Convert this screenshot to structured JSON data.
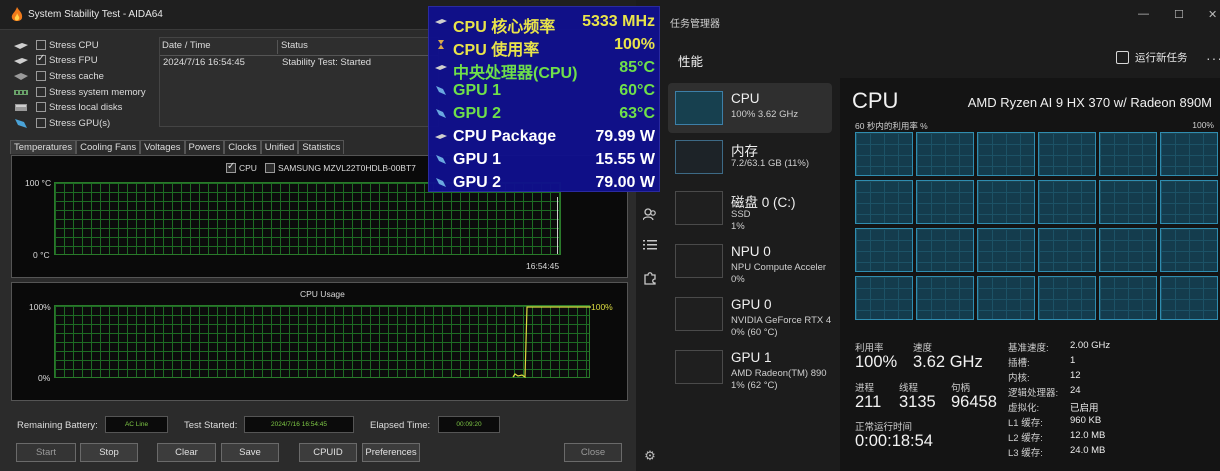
{
  "aida": {
    "title": "System Stability Test - AIDA64",
    "stress_items": [
      {
        "label": "Stress CPU",
        "checked": false,
        "icon": "cpu-icon"
      },
      {
        "label": "Stress FPU",
        "checked": true,
        "icon": "fpu-icon"
      },
      {
        "label": "Stress cache",
        "checked": false,
        "icon": "cache-icon"
      },
      {
        "label": "Stress system memory",
        "checked": false,
        "icon": "memory-icon"
      },
      {
        "label": "Stress local disks",
        "checked": false,
        "icon": "disk-icon"
      },
      {
        "label": "Stress GPU(s)",
        "checked": false,
        "icon": "gpu-icon"
      }
    ],
    "status_table": {
      "headers": [
        "Date / Time",
        "Status"
      ],
      "rows": [
        [
          "2024/7/16 16:54:45",
          "Stability Test: Started"
        ]
      ]
    },
    "tabs": [
      "Temperatures",
      "Cooling Fans",
      "Voltages",
      "Powers",
      "Clocks",
      "Unified",
      "Statistics"
    ],
    "active_tab": "Temperatures",
    "temp_graph": {
      "legend": [
        {
          "label": "CPU",
          "checked": true
        },
        {
          "label": "SAMSUNG MZVL22T0HDLB-00BT7",
          "checked": false
        }
      ],
      "y_max": "100 °C",
      "y_min": "0 °C",
      "x_time": "16:54:45"
    },
    "usage_graph": {
      "title": "CPU Usage",
      "y_max": "100%",
      "y_min": "0%",
      "value_label": "100%"
    },
    "bottom": {
      "battery_label": "Remaining Battery:",
      "battery_value": "AC Line",
      "started_label": "Test Started:",
      "started_value": "2024/7/16 16:54:45",
      "elapsed_label": "Elapsed Time:",
      "elapsed_value": "00:09:20"
    },
    "buttons": {
      "start": "Start",
      "stop": "Stop",
      "clear": "Clear",
      "save": "Save",
      "cpuid": "CPUID",
      "preferences": "Preferences",
      "close": "Close"
    }
  },
  "osd": {
    "rows": [
      {
        "label": "CPU 核心频率",
        "value": "5333 MHz",
        "color": "#e9e44a",
        "icon": "clock-icon"
      },
      {
        "label": "CPU 使用率",
        "value": "100%",
        "color": "#e9e44a",
        "icon": "hourglass-icon"
      },
      {
        "label": "中央处理器(CPU)",
        "value": "85°C",
        "color": "#6fe04a",
        "icon": "cpu-temp-icon"
      },
      {
        "label": "GPU 1",
        "value": "60°C",
        "color": "#6fe04a",
        "icon": "gpu-temp-icon"
      },
      {
        "label": "GPU 2",
        "value": "63°C",
        "color": "#6fe04a",
        "icon": "gpu-temp-icon"
      },
      {
        "label": "CPU Package",
        "value": "79.99 W",
        "color": "#ffffff",
        "icon": "cpu-power-icon"
      },
      {
        "label": "GPU 1",
        "value": "15.55 W",
        "color": "#ffffff",
        "icon": "gpu-power-icon"
      },
      {
        "label": "GPU 2",
        "value": "79.00 W",
        "color": "#ffffff",
        "icon": "gpu-power-icon"
      }
    ]
  },
  "tm": {
    "title": "任务管理器",
    "section": "性能",
    "new_task": "运行新任务",
    "devices": [
      {
        "name": "CPU",
        "line1": "100%  3.62 GHz",
        "line2": "",
        "selected": true
      },
      {
        "name": "内存",
        "line1": "7.2/63.1 GB (11%)",
        "line2": "",
        "selected": false
      },
      {
        "name": "磁盘 0 (C:)",
        "line1": "SSD",
        "line2": "1%",
        "selected": false
      },
      {
        "name": "NPU 0",
        "line1": "NPU Compute Acceler",
        "line2": "0%",
        "selected": false
      },
      {
        "name": "GPU 0",
        "line1": "NVIDIA GeForce RTX 4",
        "line2": "0%  (60 °C)",
        "selected": false
      },
      {
        "name": "GPU 1",
        "line1": "AMD Radeon(TM) 890",
        "line2": "1%  (62 °C)",
        "selected": false
      }
    ],
    "cpu": {
      "heading": "CPU",
      "model": "AMD Ryzen AI 9 HX 370 w/ Radeon 890M",
      "util_label": "60 秒内的利用率 %",
      "util_max": "100%",
      "core_count": 24,
      "core_utilization_pct": 100,
      "stats": {
        "util_label": "利用率",
        "util_value": "100%",
        "speed_label": "速度",
        "speed_value": "3.62 GHz",
        "proc_label": "进程",
        "proc_value": "211",
        "thread_label": "线程",
        "thread_value": "3135",
        "handle_label": "句柄",
        "handle_value": "96458",
        "uptime_label": "正常运行时间",
        "uptime_value": "0:00:18:54"
      },
      "details": [
        {
          "k": "基准速度:",
          "v": "2.00 GHz"
        },
        {
          "k": "插槽:",
          "v": "1"
        },
        {
          "k": "内核:",
          "v": "12"
        },
        {
          "k": "逻辑处理器:",
          "v": "24"
        },
        {
          "k": "虚拟化:",
          "v": "已启用"
        },
        {
          "k": "L1 缓存:",
          "v": "960 KB"
        },
        {
          "k": "L2 缓存:",
          "v": "12.0 MB"
        },
        {
          "k": "L3 缓存:",
          "v": "24.0 MB"
        }
      ]
    }
  }
}
